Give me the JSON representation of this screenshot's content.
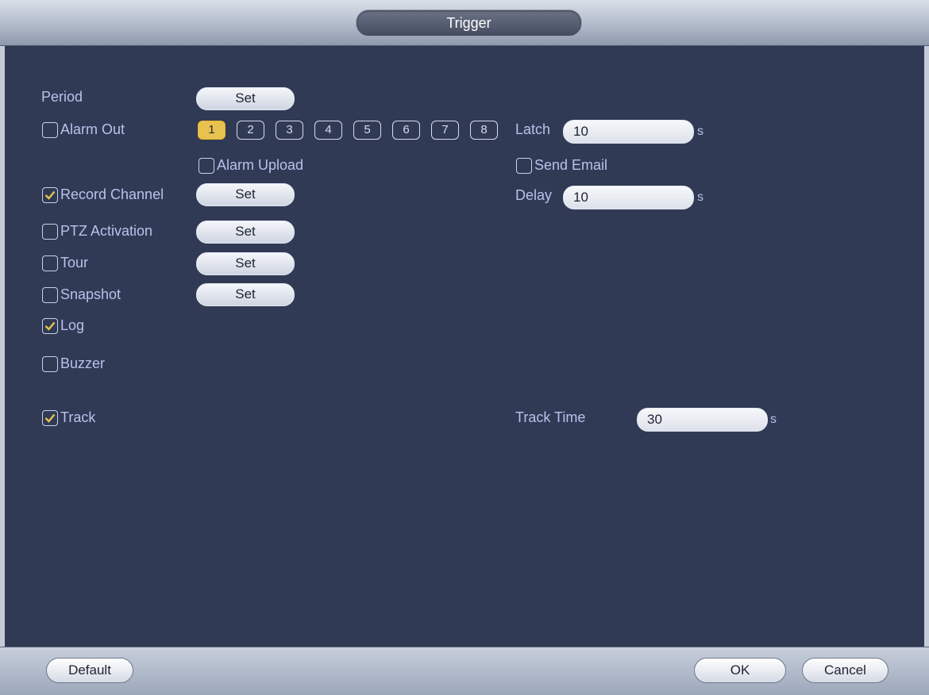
{
  "window": {
    "title": "Trigger"
  },
  "period": {
    "label": "Period",
    "button": "Set"
  },
  "alarm_out": {
    "label": "Alarm Out",
    "checked": false,
    "channels": [
      "1",
      "2",
      "3",
      "4",
      "5",
      "6",
      "7",
      "8"
    ],
    "active_channel": "1",
    "latch_label": "Latch",
    "latch_value": "10",
    "latch_unit": "s"
  },
  "alarm_upload": {
    "label": "Alarm Upload",
    "checked": false
  },
  "send_email": {
    "label": "Send Email",
    "checked": false
  },
  "record_channel": {
    "label": "Record Channel",
    "checked": true,
    "button": "Set",
    "delay_label": "Delay",
    "delay_value": "10",
    "delay_unit": "s"
  },
  "ptz_activation": {
    "label": "PTZ Activation",
    "checked": false,
    "button": "Set"
  },
  "tour": {
    "label": "Tour",
    "checked": false,
    "button": "Set"
  },
  "snapshot": {
    "label": "Snapshot",
    "checked": false,
    "button": "Set"
  },
  "log": {
    "label": "Log",
    "checked": true
  },
  "buzzer": {
    "label": "Buzzer",
    "checked": false
  },
  "track": {
    "label": "Track",
    "checked": true,
    "time_label": "Track Time",
    "time_value": "30",
    "time_unit": "s"
  },
  "footer": {
    "default": "Default",
    "ok": "OK",
    "cancel": "Cancel"
  },
  "colors": {
    "background": "#313a55",
    "label": "#b6c3ea",
    "active_channel": "#e7c24f"
  }
}
